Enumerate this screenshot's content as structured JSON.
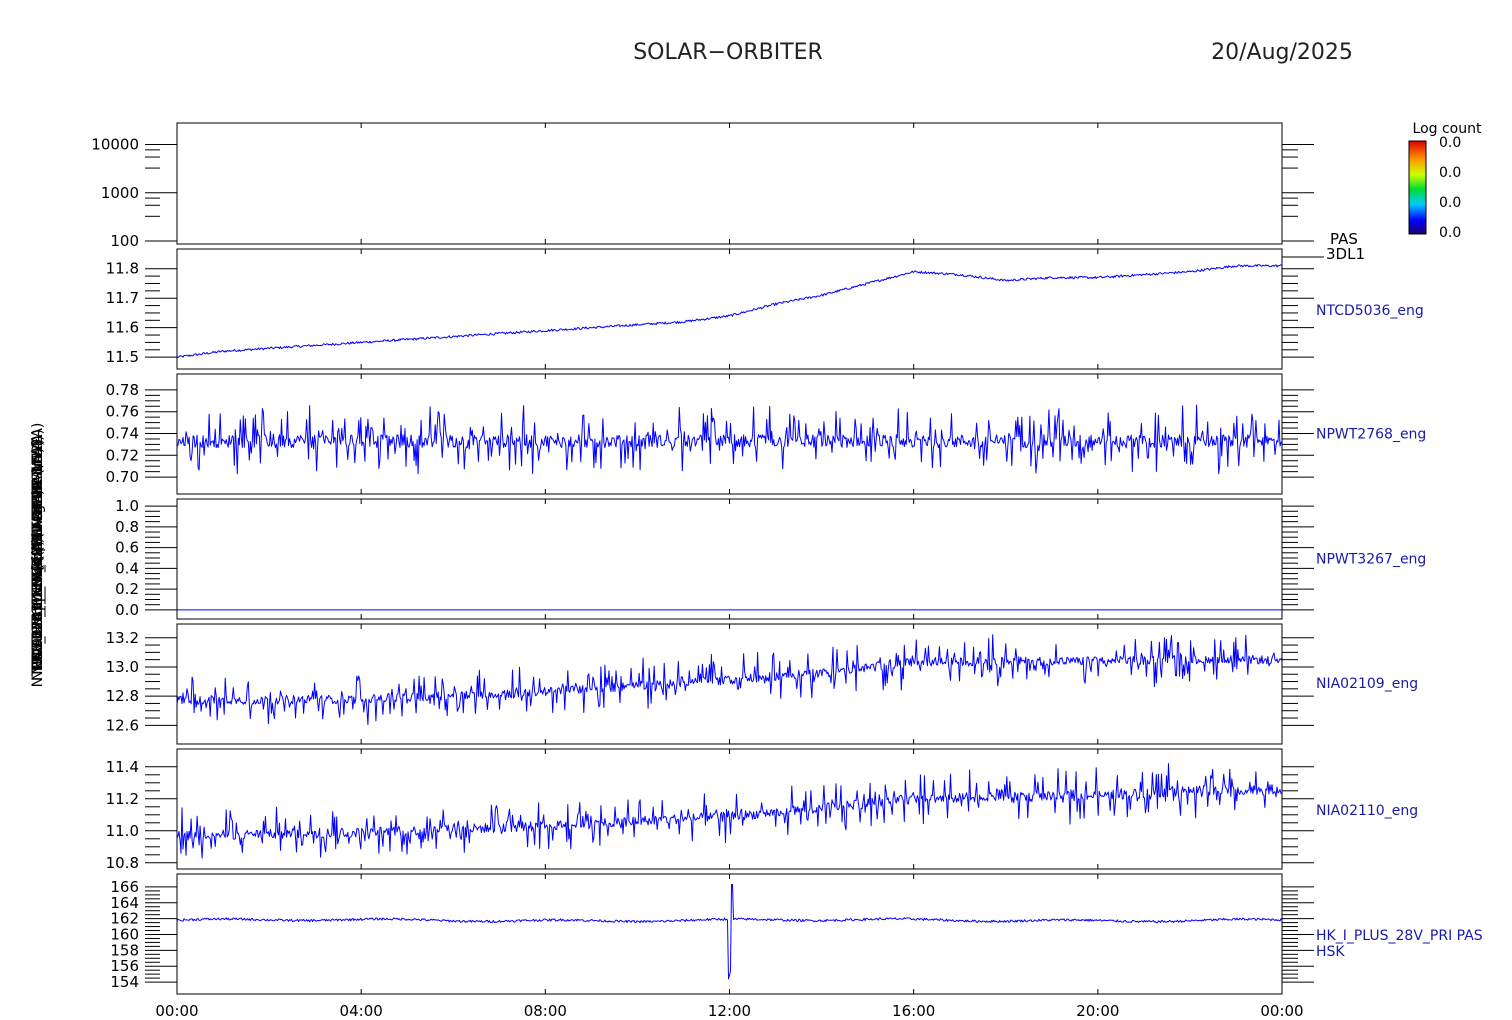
{
  "header": {
    "mission": "SOLAR−ORBITER",
    "date": "20/Aug/2025"
  },
  "colorbar": {
    "title": "Log count",
    "labels": [
      "0.0",
      "0.0",
      "0.0",
      "0.0"
    ]
  },
  "y_axis_labels": [
    "(eV)",
    "Appx Temp (DegC)",
    "NTCD5036_ENG (ASW FOBVRSMV EA)",
    "NPWT2768_ENG (ASW-TEMP-1 1A)",
    "NPWT3267_ENG (ASW-ALARM-1 2A)",
    "NIA02109_ENG (PDU 24 uA 3/5V)",
    "NIA02110_ENG (HLTR-MCA uA)",
    "PAS_HK_IMON_THERMFILTR (mA)",
    "(mA)"
  ],
  "chart_data": {
    "type": "line",
    "x_axis": {
      "ticks": [
        "00:00",
        "04:00",
        "08:00",
        "12:00",
        "16:00",
        "20:00",
        "00:00"
      ],
      "range_hours": [
        0,
        24
      ]
    },
    "panels": [
      {
        "name": "PAS 3DL1",
        "type": "heatmap",
        "scale": "log",
        "ylim": [
          100,
          20000
        ],
        "ytick_labels": [
          "100",
          "1000",
          "10000"
        ],
        "ytick_values": [
          100,
          1000,
          10000
        ],
        "side_label": [
          "PAS",
          "3DL1"
        ],
        "data": []
      },
      {
        "name": "NTCD5036_eng",
        "style": "thin",
        "ylim": [
          11.47,
          11.85
        ],
        "ytick_labels": [
          "11.5",
          "11.6",
          "11.7",
          "11.8"
        ],
        "ytick_values": [
          11.5,
          11.6,
          11.7,
          11.8
        ],
        "side_label": [
          "NTCD5036_eng"
        ],
        "x": [
          0,
          1,
          2,
          3,
          4,
          5,
          6,
          7,
          8,
          9,
          10,
          11,
          12,
          13,
          14,
          15,
          16,
          17,
          18,
          19,
          20,
          21,
          22,
          23,
          24
        ],
        "y": [
          11.5,
          11.52,
          11.53,
          11.54,
          11.55,
          11.56,
          11.57,
          11.58,
          11.59,
          11.6,
          11.61,
          11.62,
          11.64,
          11.68,
          11.71,
          11.75,
          11.79,
          11.78,
          11.76,
          11.77,
          11.77,
          11.78,
          11.79,
          11.81,
          11.81
        ],
        "noise": 0.004
      },
      {
        "name": "NPWT2768_eng",
        "style": "noisy",
        "ylim": [
          0.69,
          0.79
        ],
        "ytick_labels": [
          "0.70",
          "0.72",
          "0.74",
          "0.76",
          "0.78"
        ],
        "ytick_values": [
          0.7,
          0.72,
          0.74,
          0.76,
          0.78
        ],
        "side_label": [
          "NPWT2768_eng"
        ],
        "x": [
          0,
          24
        ],
        "y": [
          0.733,
          0.733
        ],
        "noise": 0.006,
        "spike": 0.028
      },
      {
        "name": "NPWT3267_eng",
        "style": "thin",
        "ylim": [
          -0.03,
          1.02
        ],
        "ytick_labels": [
          "0.0",
          "0.2",
          "0.4",
          "0.6",
          "0.8",
          "1.0"
        ],
        "ytick_values": [
          0.0,
          0.2,
          0.4,
          0.6,
          0.8,
          1.0
        ],
        "side_label": [
          "NPWT3267_eng"
        ],
        "x": [
          0,
          24
        ],
        "y": [
          0.0,
          0.0
        ],
        "noise": 0
      },
      {
        "name": "NIA02109_eng",
        "style": "noisy",
        "ylim": [
          12.52,
          13.26
        ],
        "ytick_labels": [
          "12.6",
          "12.8",
          "13.0",
          "13.2"
        ],
        "ytick_values": [
          12.6,
          12.8,
          13.0,
          13.2
        ],
        "side_label": [
          "NIA02109_eng"
        ],
        "x": [
          0,
          4,
          8,
          10.5,
          12,
          14,
          16,
          18,
          20,
          22,
          24
        ],
        "y": [
          12.77,
          12.78,
          12.83,
          12.88,
          12.91,
          12.96,
          13.03,
          13.04,
          13.04,
          13.05,
          13.05
        ],
        "noise": 0.03,
        "spike": 0.16
      },
      {
        "name": "NIA02110_eng",
        "style": "noisy",
        "ylim": [
          10.78,
          11.48
        ],
        "ytick_labels": [
          "10.8",
          "11.0",
          "11.2",
          "11.4"
        ],
        "ytick_values": [
          10.8,
          11.0,
          11.2,
          11.4
        ],
        "side_label": [
          "NIA02110_eng"
        ],
        "x": [
          0,
          4,
          8,
          10.5,
          12,
          14,
          16,
          18,
          20,
          22,
          24
        ],
        "y": [
          10.97,
          10.99,
          11.03,
          11.07,
          11.09,
          11.14,
          11.2,
          11.21,
          11.22,
          11.25,
          11.26
        ],
        "noise": 0.03,
        "spike": 0.15
      },
      {
        "name": "HK_I_PLUS_28V_PRI PAS HSK",
        "style": "thin",
        "ylim": [
          153,
          167
        ],
        "ytick_labels": [
          "154",
          "156",
          "158",
          "160",
          "162",
          "164",
          "166"
        ],
        "ytick_values": [
          154,
          156,
          158,
          160,
          162,
          164,
          166
        ],
        "side_label": [
          "HK_I_PLUS_28V_PRI PAS",
          "HSK"
        ],
        "x": [
          0,
          24
        ],
        "y": [
          161.8,
          161.8
        ],
        "noise": 0.15,
        "wave": 0.2,
        "event": {
          "x": 12.05,
          "min": 154.0,
          "max": 166.3
        }
      }
    ]
  },
  "colors": {
    "trace": "#0000ff",
    "axes": "#000000",
    "side_label": "#1a1aa8"
  }
}
